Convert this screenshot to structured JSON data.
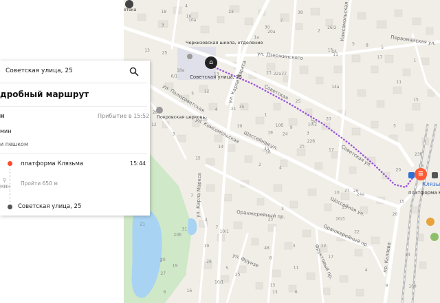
{
  "map": {
    "place_labels": {
      "school": "Черкизовская школа, отделение",
      "destination": "Советская улица, 25",
      "church": "Покровская церковь",
      "station": "Клязьма",
      "station_platform": "платформа Клязьма",
      "atm_top": "отека"
    },
    "street_labels": {
      "pervomayskaya": "Первомайская ул.",
      "dzerzhinskogo": "ул. Дзержинского",
      "karla_marksa": "ул. Карла Маркса",
      "karla_marksa2": "ул. Карла Маркса",
      "sovetskaya1": "Советская",
      "sovetskaya2": "Советская ул.",
      "shosseynaya1": "Шоссейная ул.",
      "shosseynaya2": "Шоссейная ул.",
      "pionerskaya": "ул. Полюсоветская",
      "komsomol": "ул. Комсомольская",
      "komsomolskaya": "Комсомольская ул.",
      "oranzhereyny": "Оранжерейный пр.",
      "frunze": "ул. Фрунзе",
      "pushkina": "ул. Пушкина",
      "kaj": "пр. Каляева",
      "fruktovy": "Фруктовый пр.",
      "komsomolskaya_bottom": "Оранжерейный пр."
    },
    "house_numbers": [
      "4",
      "6/1",
      "18",
      "20",
      "10/2",
      "10/1",
      "26/2",
      "22",
      "24",
      "25",
      "10а",
      "10б",
      "3",
      "1",
      "2",
      "14а",
      "16",
      "23",
      "25",
      "31",
      "35",
      "27",
      "28",
      "22а",
      "20",
      "24а",
      "18а",
      "20а",
      "12",
      "10",
      "15",
      "4а",
      "48",
      "19",
      "13",
      "5",
      "7",
      "9",
      "24",
      "26",
      "38",
      "21",
      "13б",
      "10/3",
      "10/1",
      "1",
      "3",
      "6",
      "8",
      "22б",
      "20б",
      "11",
      "13",
      "15",
      "17",
      "19",
      "16",
      "18",
      "3",
      "5",
      "7",
      "14",
      "10",
      "12",
      "8",
      "4",
      "2",
      "1а",
      "10б",
      "21",
      "23",
      "25",
      "27",
      "4",
      "2",
      "3",
      "5",
      "7",
      "1",
      "11",
      "9",
      "19",
      "17",
      "15",
      "13",
      "5",
      "3",
      "4",
      "6",
      "12",
      "30",
      "18",
      "20",
      "22",
      "24",
      "26",
      "28",
      "13",
      "15",
      "11",
      "15",
      "23",
      "23б",
      "9",
      "7",
      "3",
      "5",
      "1",
      "17",
      "19",
      "20",
      "25"
    ]
  },
  "panel": {
    "search_value": "Советская улица, 25",
    "route_title": "дробный маршрут",
    "summary_duration": "н",
    "arrival": "Прибытие в 15:52",
    "minutes": "мин",
    "walk_note": "и пешком",
    "stop_start_name": "платформа Клязьма",
    "stop_start_time": "15:44",
    "walk_label": "Пройти 650 м",
    "walk_short": "мин",
    "stop_end_name": "Советская улица, 25"
  },
  "colors": {
    "route": "#9b59d6",
    "road": "#ffffff",
    "block": "#e6e3dd",
    "water": "#a8d3f2",
    "park": "#cfe8c7",
    "accent": "#ff5a36",
    "rail": "#bcbcbc",
    "end_dot": "#555555",
    "start_dot": "#ff4b28"
  }
}
